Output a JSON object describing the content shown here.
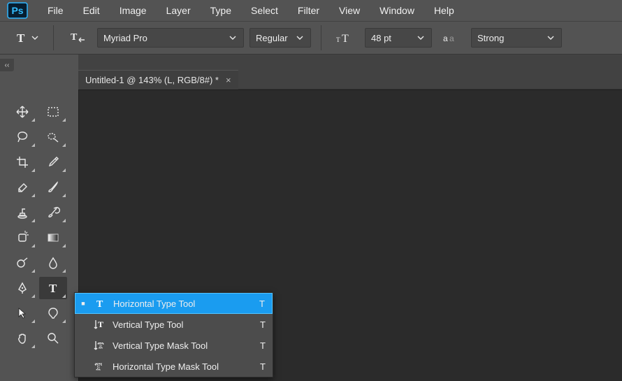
{
  "app": {
    "logo_letters": "Ps"
  },
  "menu": {
    "items": [
      "File",
      "Edit",
      "Image",
      "Layer",
      "Type",
      "Select",
      "Filter",
      "View",
      "Window",
      "Help"
    ]
  },
  "options": {
    "font_family": "Myriad Pro",
    "font_style": "Regular",
    "font_size": "48 pt",
    "antialias": "Strong"
  },
  "document": {
    "tab_title": "Untitled-1 @ 143% (L, RGB/8#) *",
    "close_glyph": "×"
  },
  "collapse": {
    "glyph": "‹‹"
  },
  "toolbox": {
    "tools": [
      {
        "name": "move-tool",
        "has_flyout": true
      },
      {
        "name": "marquee-tool",
        "has_flyout": true
      },
      {
        "name": "lasso-tool",
        "has_flyout": true
      },
      {
        "name": "quick-selection-tool",
        "has_flyout": true
      },
      {
        "name": "crop-tool",
        "has_flyout": true
      },
      {
        "name": "eyedropper-tool",
        "has_flyout": true
      },
      {
        "name": "eraser-tool",
        "has_flyout": true
      },
      {
        "name": "brush-tool",
        "has_flyout": true
      },
      {
        "name": "clone-stamp-tool",
        "has_flyout": true
      },
      {
        "name": "history-brush-tool",
        "has_flyout": true
      },
      {
        "name": "spot-heal-tool",
        "has_flyout": true
      },
      {
        "name": "gradient-tool",
        "has_flyout": true
      },
      {
        "name": "dodge-tool",
        "has_flyout": true
      },
      {
        "name": "blur-tool",
        "has_flyout": true
      },
      {
        "name": "pen-tool",
        "has_flyout": true
      },
      {
        "name": "type-tool",
        "has_flyout": true,
        "selected": true
      },
      {
        "name": "path-select-tool",
        "has_flyout": true
      },
      {
        "name": "shape-tool",
        "has_flyout": true
      },
      {
        "name": "hand-tool",
        "has_flyout": true
      },
      {
        "name": "zoom-tool",
        "has_flyout": false
      }
    ]
  },
  "flyout": {
    "items": [
      {
        "label": "Horizontal Type Tool",
        "shortcut": "T",
        "selected": true,
        "icon": "horizontal-type-icon"
      },
      {
        "label": "Vertical Type Tool",
        "shortcut": "T",
        "selected": false,
        "icon": "vertical-type-icon"
      },
      {
        "label": "Vertical Type Mask Tool",
        "shortcut": "T",
        "selected": false,
        "icon": "vertical-type-mask-icon"
      },
      {
        "label": "Horizontal Type Mask Tool",
        "shortcut": "T",
        "selected": false,
        "icon": "horizontal-type-mask-icon"
      }
    ]
  }
}
